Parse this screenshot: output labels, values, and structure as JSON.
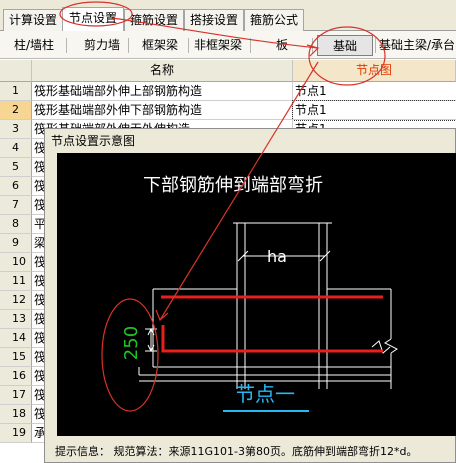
{
  "top_tabs": [
    "计算设置",
    "节点设置",
    "箍筋设置",
    "搭接设置",
    "箍筋公式"
  ],
  "active_top_tab": "节点设置",
  "sub_tabs": [
    "柱/墙柱",
    "剪力墙",
    "框架梁",
    "非框架梁",
    "板",
    "基础",
    "基础主梁/承台"
  ],
  "active_sub_tab": "基础",
  "grid": {
    "columns": {
      "name": "名称",
      "node": "节点图"
    },
    "rows": [
      {
        "no": "1",
        "name": "筏形基础端部外伸上部钢筋构造",
        "node": "节点1"
      },
      {
        "no": "2",
        "name": "筏形基础端部外伸下部钢筋构造",
        "node": "节点1"
      },
      {
        "no": "3",
        "name": "筏形基础端部外伸无外伸构造",
        "node": "节点1"
      },
      {
        "no": "4",
        "name": "筏",
        "node": ""
      },
      {
        "no": "5",
        "name": "筏",
        "node": ""
      },
      {
        "no": "6",
        "name": "筏",
        "node": ""
      },
      {
        "no": "7",
        "name": "筏",
        "node": ""
      },
      {
        "no": "8",
        "name": "平",
        "node": ""
      },
      {
        "no": "9",
        "name": "梁",
        "node": ""
      },
      {
        "no": "10",
        "name": "筏",
        "node": ""
      },
      {
        "no": "11",
        "name": "筏",
        "node": ""
      },
      {
        "no": "12",
        "name": "筏",
        "node": ""
      },
      {
        "no": "13",
        "name": "筏",
        "node": ""
      },
      {
        "no": "14",
        "name": "筏",
        "node": ""
      },
      {
        "no": "15",
        "name": "筏",
        "node": ""
      },
      {
        "no": "16",
        "name": "筏",
        "node": ""
      },
      {
        "no": "17",
        "name": "筏",
        "node": ""
      },
      {
        "no": "18",
        "name": "筏",
        "node": ""
      },
      {
        "no": "19",
        "name": "承",
        "node": ""
      }
    ],
    "selected_row": "2"
  },
  "dialog": {
    "title": "节点设置示意图",
    "diagram_title": "下部钢筋伸到端部弯折",
    "dimension_label": "ha",
    "bend_length": "250",
    "node_caption": "节点一",
    "hint": "提示信息： 规范算法：来源11G101-3第80页。底筋伸到端部弯折12*d。"
  },
  "colors": {
    "rebar": "#e8201c",
    "annotation": "#d8332b",
    "dim_text": "#21c421",
    "caption": "#27b7f3",
    "node_header": "#e03a00"
  }
}
